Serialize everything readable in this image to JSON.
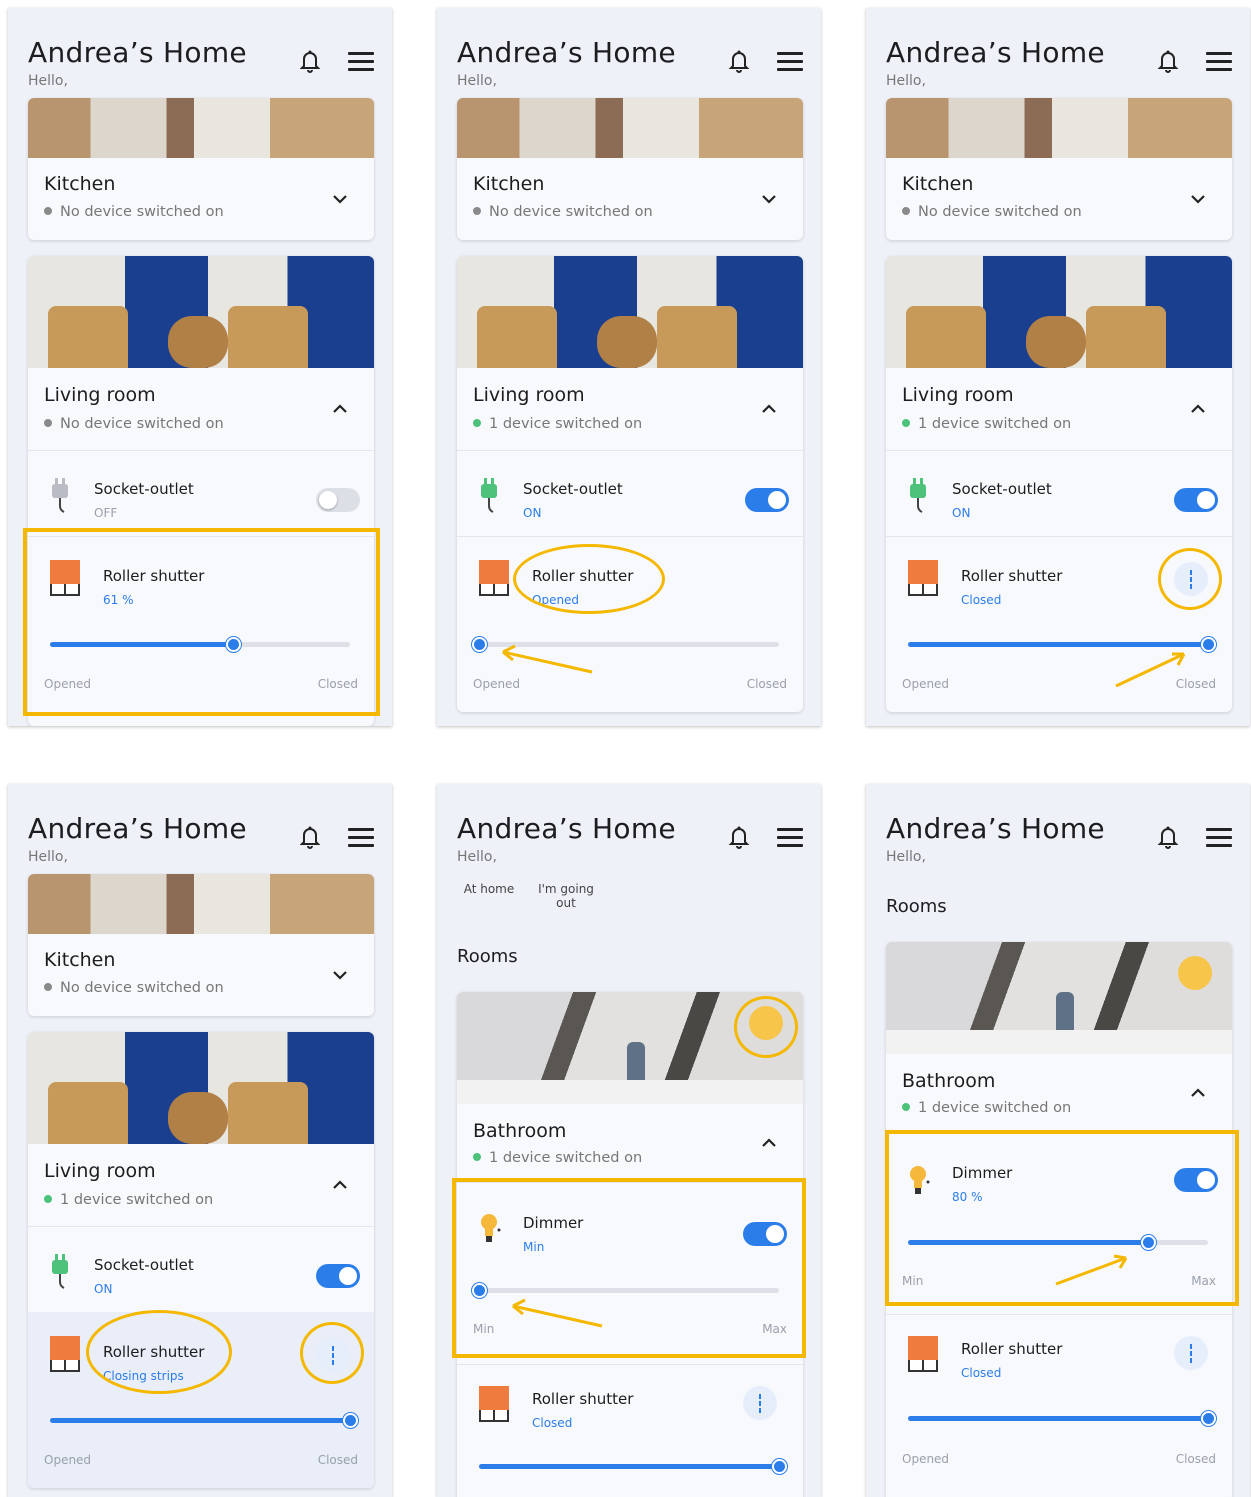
{
  "app": {
    "title": "Andrea’s Home",
    "hello": "Hello,",
    "rooms_heading": "Rooms"
  },
  "modes": {
    "at_home": "At home",
    "going_out": "I'm going out"
  },
  "rooms": {
    "kitchen": {
      "name": "Kitchen",
      "status": "No device switched on"
    },
    "living_off": {
      "name": "Living room",
      "status": "No device switched on"
    },
    "living_on": {
      "name": "Living room",
      "status": "1 device switched on"
    },
    "bathroom": {
      "name": "Bathroom",
      "status": "1 device switched on"
    }
  },
  "devices": {
    "socket": {
      "name": "Socket-outlet",
      "off": "OFF",
      "on": "ON"
    },
    "shutter": {
      "name": "Roller shutter",
      "pct": "61 %",
      "opened": "Opened",
      "closed": "Closed",
      "closing": "Closing strips",
      "open_label": "Opened",
      "closed_label": "Closed",
      "values": {
        "s1": 61,
        "s2": 0,
        "s3": 100,
        "s4": 100,
        "s5": 100,
        "s6": 100
      }
    },
    "dimmer": {
      "name": "Dimmer",
      "min": "Min",
      "pct": "80 %",
      "min_label": "Min",
      "max_label": "Max",
      "values": {
        "s5": 0,
        "s6": 80
      }
    }
  },
  "colors": {
    "accent": "#2b7de9",
    "highlight": "#f5b800",
    "on_dot": "#4cc27a",
    "off_dot": "#8a8a8a",
    "shutter": "#f07b3f"
  },
  "icons": [
    "bell-icon",
    "menu-icon",
    "chevron-down-icon",
    "chevron-up-icon",
    "plug-icon",
    "shutter-icon",
    "bulb-icon",
    "kebab-icon",
    "sun-icon"
  ]
}
